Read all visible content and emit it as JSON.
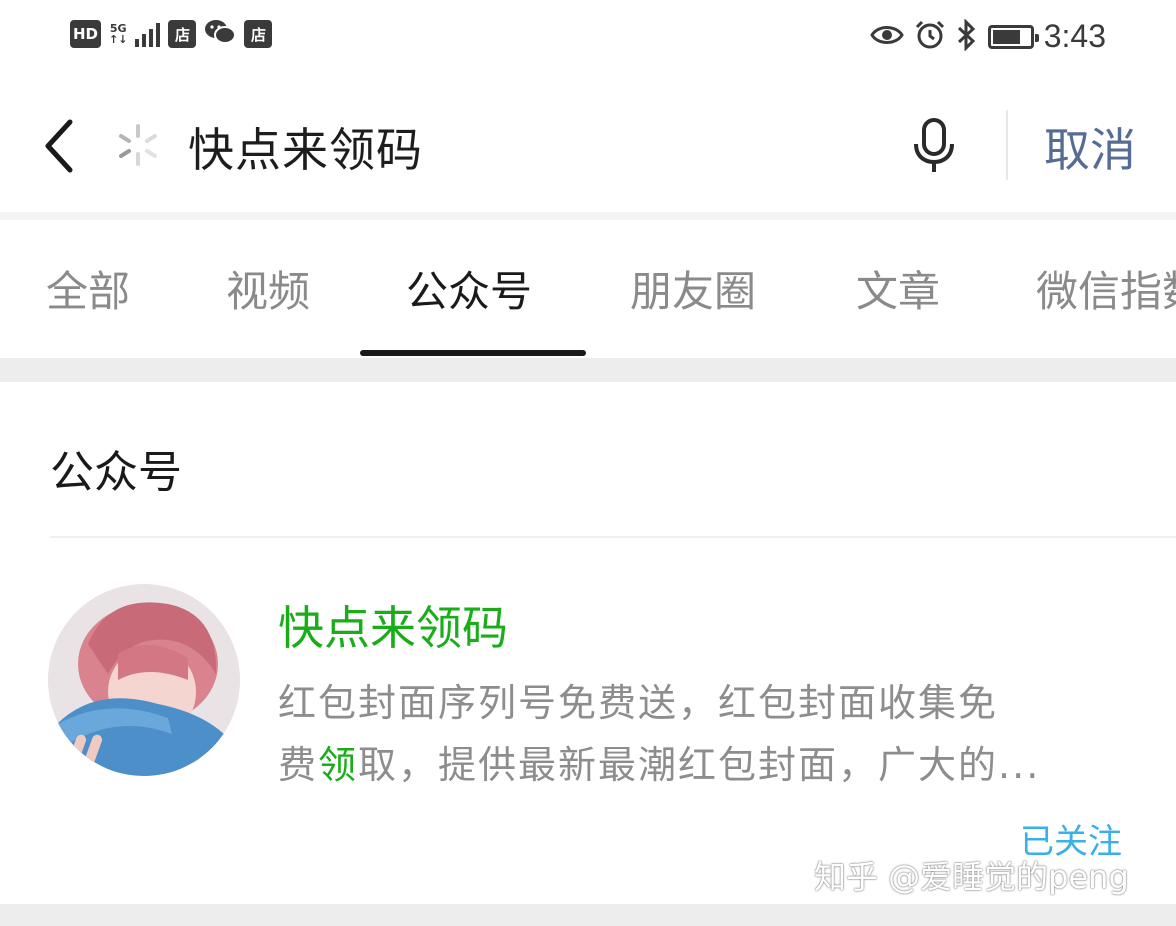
{
  "status_bar": {
    "left_badges": [
      "HD",
      "店",
      "店"
    ],
    "network": "5G",
    "time": "3:43",
    "battery_level": 0.75,
    "icons": [
      "eye-icon",
      "alarm-icon",
      "bluetooth-icon",
      "battery-icon"
    ]
  },
  "search": {
    "query": "快点来领码",
    "cancel_label": "取消",
    "icons": [
      "back-icon",
      "loading-icon",
      "microphone-icon"
    ]
  },
  "tabs": {
    "items": [
      "全部",
      "视频",
      "公众号",
      "朋友圈",
      "文章",
      "微信指数"
    ],
    "active_index": 2
  },
  "results": {
    "section_title": "公众号",
    "account": {
      "name": "快点来领码",
      "desc_line1": "红包封面序列号免费送，红包封面收集免",
      "desc_line2_pre": "费",
      "desc_line2_hl": "领",
      "desc_line2_post": "取，提供最新最潮红包封面，广大的...",
      "follow_status": "已关注"
    }
  },
  "watermark": "知乎 @爱睡觉的peng",
  "colors": {
    "accent_green": "#1aad19",
    "link_blue": "#576b95",
    "followed_blue": "#3ab0e8"
  }
}
